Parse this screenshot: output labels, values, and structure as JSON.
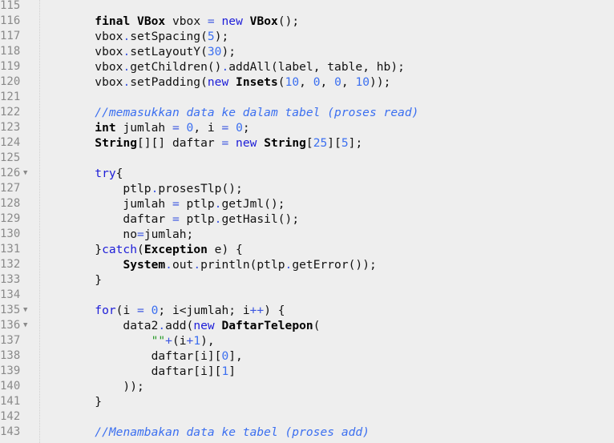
{
  "editor": {
    "colors": {
      "background": "#eeeeee",
      "keyword": "#1d1dd8",
      "number": "#3b6ff0",
      "comment": "#3b6ff0",
      "string": "#2a9a2a",
      "line_number": "#8a8a8a"
    },
    "fold_icon": "triangle-down",
    "lines": [
      {
        "n": "115",
        "fold": false,
        "tokens": []
      },
      {
        "n": "116",
        "fold": false,
        "tokens": [
          [
            "        ",
            "p"
          ],
          [
            "final",
            "b"
          ],
          [
            " ",
            "p"
          ],
          [
            "VBox",
            "b"
          ],
          [
            " vbox ",
            "p"
          ],
          [
            "=",
            "o"
          ],
          [
            " ",
            "p"
          ],
          [
            "new",
            "k"
          ],
          [
            " ",
            "p"
          ],
          [
            "VBox",
            "b"
          ],
          [
            "();",
            "p"
          ]
        ]
      },
      {
        "n": "117",
        "fold": false,
        "tokens": [
          [
            "        vbox",
            "p"
          ],
          [
            ".",
            "o"
          ],
          [
            "setSpacing(",
            "p"
          ],
          [
            "5",
            "n"
          ],
          [
            ");",
            "p"
          ]
        ]
      },
      {
        "n": "118",
        "fold": false,
        "tokens": [
          [
            "        vbox",
            "p"
          ],
          [
            ".",
            "o"
          ],
          [
            "setLayoutY(",
            "p"
          ],
          [
            "30",
            "n"
          ],
          [
            ");",
            "p"
          ]
        ]
      },
      {
        "n": "119",
        "fold": false,
        "tokens": [
          [
            "        vbox",
            "p"
          ],
          [
            ".",
            "o"
          ],
          [
            "getChildren()",
            "p"
          ],
          [
            ".",
            "o"
          ],
          [
            "addAll(label, table, hb);",
            "p"
          ]
        ]
      },
      {
        "n": "120",
        "fold": false,
        "tokens": [
          [
            "        vbox",
            "p"
          ],
          [
            ".",
            "o"
          ],
          [
            "setPadding(",
            "p"
          ],
          [
            "new",
            "k"
          ],
          [
            " ",
            "p"
          ],
          [
            "Insets",
            "b"
          ],
          [
            "(",
            "p"
          ],
          [
            "10",
            "n"
          ],
          [
            ", ",
            "p"
          ],
          [
            "0",
            "n"
          ],
          [
            ", ",
            "p"
          ],
          [
            "0",
            "n"
          ],
          [
            ", ",
            "p"
          ],
          [
            "10",
            "n"
          ],
          [
            "));",
            "p"
          ]
        ]
      },
      {
        "n": "121",
        "fold": false,
        "tokens": []
      },
      {
        "n": "122",
        "fold": false,
        "tokens": [
          [
            "        ",
            "p"
          ],
          [
            "//memasukkan data ke dalam tabel (proses read)",
            "c"
          ]
        ]
      },
      {
        "n": "123",
        "fold": false,
        "tokens": [
          [
            "        ",
            "p"
          ],
          [
            "int",
            "b"
          ],
          [
            " jumlah ",
            "p"
          ],
          [
            "=",
            "o"
          ],
          [
            " ",
            "p"
          ],
          [
            "0",
            "n"
          ],
          [
            ", i ",
            "p"
          ],
          [
            "=",
            "o"
          ],
          [
            " ",
            "p"
          ],
          [
            "0",
            "n"
          ],
          [
            ";",
            "p"
          ]
        ]
      },
      {
        "n": "124",
        "fold": false,
        "tokens": [
          [
            "        ",
            "p"
          ],
          [
            "String",
            "b"
          ],
          [
            "[][] daftar ",
            "p"
          ],
          [
            "=",
            "o"
          ],
          [
            " ",
            "p"
          ],
          [
            "new",
            "k"
          ],
          [
            " ",
            "p"
          ],
          [
            "String",
            "b"
          ],
          [
            "[",
            "p"
          ],
          [
            "25",
            "n"
          ],
          [
            "][",
            "p"
          ],
          [
            "5",
            "n"
          ],
          [
            "];",
            "p"
          ]
        ]
      },
      {
        "n": "125",
        "fold": false,
        "tokens": []
      },
      {
        "n": "126",
        "fold": true,
        "tokens": [
          [
            "        ",
            "p"
          ],
          [
            "try",
            "k"
          ],
          [
            "{",
            "p"
          ]
        ]
      },
      {
        "n": "127",
        "fold": false,
        "tokens": [
          [
            "            ptlp",
            "p"
          ],
          [
            ".",
            "o"
          ],
          [
            "prosesTlp();",
            "p"
          ]
        ]
      },
      {
        "n": "128",
        "fold": false,
        "tokens": [
          [
            "            jumlah ",
            "p"
          ],
          [
            "=",
            "o"
          ],
          [
            " ptlp",
            "p"
          ],
          [
            ".",
            "o"
          ],
          [
            "getJml();",
            "p"
          ]
        ]
      },
      {
        "n": "129",
        "fold": false,
        "tokens": [
          [
            "            daftar ",
            "p"
          ],
          [
            "=",
            "o"
          ],
          [
            " ptlp",
            "p"
          ],
          [
            ".",
            "o"
          ],
          [
            "getHasil();",
            "p"
          ]
        ]
      },
      {
        "n": "130",
        "fold": false,
        "tokens": [
          [
            "            no",
            "p"
          ],
          [
            "=",
            "o"
          ],
          [
            "jumlah;",
            "p"
          ]
        ]
      },
      {
        "n": "131",
        "fold": false,
        "tokens": [
          [
            "        }",
            "p"
          ],
          [
            "catch",
            "k"
          ],
          [
            "(",
            "p"
          ],
          [
            "Exception",
            "b"
          ],
          [
            " e) {",
            "p"
          ]
        ]
      },
      {
        "n": "132",
        "fold": false,
        "tokens": [
          [
            "            ",
            "p"
          ],
          [
            "System",
            "b"
          ],
          [
            ".",
            "o"
          ],
          [
            "out",
            "p"
          ],
          [
            ".",
            "o"
          ],
          [
            "println(ptlp",
            "p"
          ],
          [
            ".",
            "o"
          ],
          [
            "getError());",
            "p"
          ]
        ]
      },
      {
        "n": "133",
        "fold": false,
        "tokens": [
          [
            "        }",
            "p"
          ]
        ]
      },
      {
        "n": "134",
        "fold": false,
        "tokens": []
      },
      {
        "n": "135",
        "fold": true,
        "tokens": [
          [
            "        ",
            "p"
          ],
          [
            "for",
            "k"
          ],
          [
            "(i ",
            "p"
          ],
          [
            "=",
            "o"
          ],
          [
            " ",
            "p"
          ],
          [
            "0",
            "n"
          ],
          [
            "; i<jumlah; i",
            "p"
          ],
          [
            "++",
            "o"
          ],
          [
            ") {",
            "p"
          ]
        ]
      },
      {
        "n": "136",
        "fold": true,
        "tokens": [
          [
            "            data2",
            "p"
          ],
          [
            ".",
            "o"
          ],
          [
            "add(",
            "p"
          ],
          [
            "new",
            "k"
          ],
          [
            " ",
            "p"
          ],
          [
            "DaftarTelepon",
            "b"
          ],
          [
            "(",
            "p"
          ]
        ]
      },
      {
        "n": "137",
        "fold": false,
        "tokens": [
          [
            "                ",
            "p"
          ],
          [
            "\"\"",
            "s"
          ],
          [
            "+",
            "o"
          ],
          [
            "(i",
            "p"
          ],
          [
            "+",
            "o"
          ],
          [
            "1",
            "n"
          ],
          [
            "),",
            "p"
          ]
        ]
      },
      {
        "n": "138",
        "fold": false,
        "tokens": [
          [
            "                daftar[i][",
            "p"
          ],
          [
            "0",
            "n"
          ],
          [
            "],",
            "p"
          ]
        ]
      },
      {
        "n": "139",
        "fold": false,
        "tokens": [
          [
            "                daftar[i][",
            "p"
          ],
          [
            "1",
            "n"
          ],
          [
            "]",
            "p"
          ]
        ]
      },
      {
        "n": "140",
        "fold": false,
        "tokens": [
          [
            "            ));",
            "p"
          ]
        ]
      },
      {
        "n": "141",
        "fold": false,
        "tokens": [
          [
            "        }",
            "p"
          ]
        ]
      },
      {
        "n": "142",
        "fold": false,
        "tokens": []
      },
      {
        "n": "143",
        "fold": false,
        "tokens": [
          [
            "        ",
            "p"
          ],
          [
            "//Menambakan data ke tabel (proses add)",
            "c"
          ]
        ]
      }
    ]
  }
}
